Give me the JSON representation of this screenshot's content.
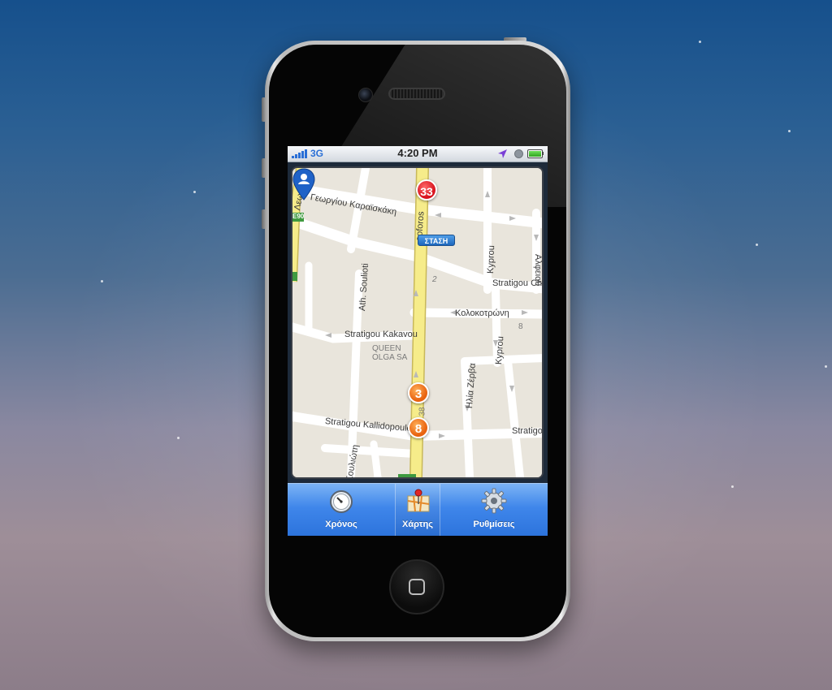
{
  "statusbar": {
    "network": "3G",
    "time": "4:20 PM"
  },
  "map": {
    "streets": {
      "georgiou_karaiskaki": "Γεωργίου Καραϊσκάκη",
      "leoforos_top": "Λεωφόρ",
      "eoforos": "eoforos",
      "ilis": "ilis",
      "kyprou_top": "Kyprou",
      "alfeiou": "Αλφειού",
      "stratigou_ch": "Stratigou Ch",
      "kolokotroni": "Κολοκοτρώνη",
      "ath_soulioti": "Ath. Soulioti",
      "stratigou_kakavou": "Stratigou Kakavou",
      "queen_olga": "QUEEN\nOLGA SA",
      "kyprou_bottom": "Kyprou",
      "ilias_label": "Ηλία Ζέρβα",
      "stratigou_kallidopoulou": "Stratigou Kallidopoulo",
      "stratigo_right": "Stratigo",
      "soulioti_bottom": "Σουλιώτη"
    },
    "numbers": {
      "n2": "2",
      "n8": "8",
      "n38": "38",
      "route_tag": "E90"
    },
    "stop_label": "ΣΤΑΣΗ",
    "markers": [
      {
        "label": "33",
        "color": "red"
      },
      {
        "label": "3",
        "color": "orange"
      },
      {
        "label": "8",
        "color": "orange"
      }
    ]
  },
  "tabbar": {
    "tabs": [
      {
        "label": "Χρόνος",
        "icon": "stopwatch-icon"
      },
      {
        "label": "Χάρτης",
        "icon": "map-icon"
      },
      {
        "label": "Ρυθμίσεις",
        "icon": "gear-icon"
      }
    ],
    "active_tab": "Χάρτης"
  },
  "colors": {
    "tabbar_blue": "#3f86ea",
    "marker_red": "#d8131e",
    "marker_orange": "#e8620f",
    "main_road_yellow": "#f6ec8a",
    "map_background": "#e9e5dc"
  }
}
